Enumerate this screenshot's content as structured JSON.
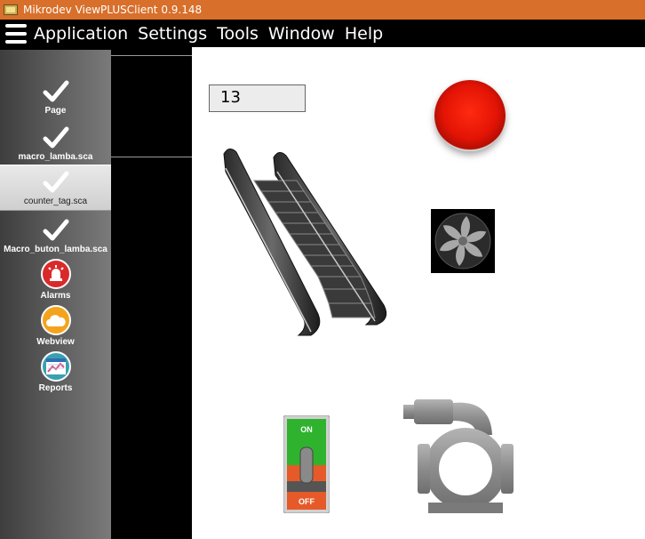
{
  "window": {
    "title": "Mikrodev ViewPLUSClient 0.9.148"
  },
  "menu": {
    "items": [
      "Application",
      "Settings",
      "Tools",
      "Window",
      "Help"
    ]
  },
  "sidebar": {
    "items": [
      {
        "label": "Page",
        "icon": "check-icon"
      },
      {
        "label": "macro_lamba.sca",
        "icon": "check-icon"
      },
      {
        "label": "counter_tag.sca",
        "icon": "check-icon",
        "active": true
      },
      {
        "label": "Macro_buton_lamba.sca",
        "icon": "check-icon"
      },
      {
        "label": "Alarms",
        "icon": "alarm-icon",
        "color": "#d92a2a"
      },
      {
        "label": "Webview",
        "icon": "cloud-icon",
        "color": "#f4a41c"
      },
      {
        "label": "Reports",
        "icon": "report-icon",
        "color": "#3aa0b0"
      }
    ]
  },
  "canvas": {
    "counter_value": "13",
    "switch": {
      "on_label": "ON",
      "off_label": "OFF"
    }
  },
  "colors": {
    "titlebar": "#d86f2a",
    "menubar": "#000000",
    "red_button": "#e31405"
  }
}
